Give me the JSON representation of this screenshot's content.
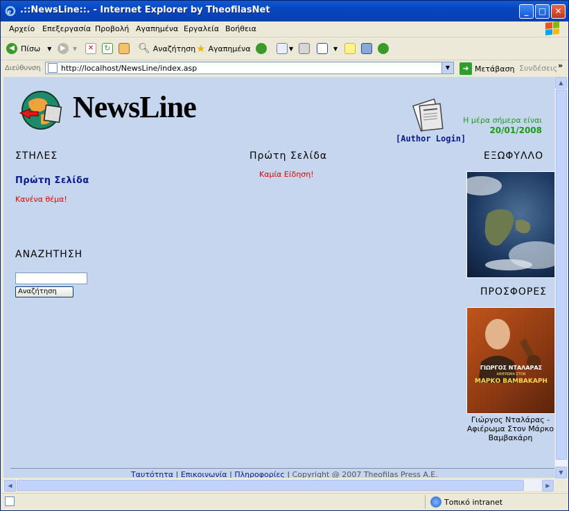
{
  "window": {
    "title": ".::NewsLine::. - Internet Explorer by TheofilasNet"
  },
  "menu": [
    "Αρχείο",
    "Επεξεργασία",
    "Προβολή",
    "Αγαπημένα",
    "Εργαλεία",
    "Βοήθεια"
  ],
  "toolbar": {
    "back": "Πίσω",
    "search": "Αναζήτηση",
    "favorites": "Αγαπημένα"
  },
  "address": {
    "label": "Διεύθυνση",
    "url": "http://localhost/NewsLine/index.asp",
    "go": "Μετάβαση",
    "links": "Συνδέσεις"
  },
  "page": {
    "brand": "NewsLine",
    "author_login": "[Author Login]",
    "date_label": "Η μέρα σήμερα είναι",
    "date_value": "20/01/2008",
    "columns_heading": "ΣΤΗΛΕΣ",
    "column_link": "Πρώτη Σελίδα",
    "no_topic": "Κανένα θέμα!",
    "search_heading": "ΑΝΑΖΗΤΗΣΗ",
    "search_value": "",
    "search_button": "Αναζήτηση",
    "center_heading": "Πρώτη Σελίδα",
    "no_news": "Καμία Είδηση!",
    "cover_heading": "ΕΞΩΦΥΛΛΟ",
    "offers_heading": "ΠΡΟΣΦΟΡΕΣ",
    "offer_image_line1": "ΓΙΩΡΓΟΣ ΝΤΑΛΑΡΑΣ",
    "offer_image_line2": "ΑΦΙΕΡΩΜΑ ΣΤΟΝ",
    "offer_image_line3": "ΜΑΡΚΟ ΒΑΜΒΑΚΑΡΗ",
    "offer_caption_1": "Γιώργος Νταλάρας -",
    "offer_caption_2": "Αφιέρωμα Στον Μάρκο",
    "offer_caption_3": "Βαμβακάρη"
  },
  "footer": {
    "link1": "Ταυτότητα",
    "link2": "Επικοινωνία",
    "link3": "Πληροφορίες",
    "sep": "|",
    "copyright": "Copyright @ 2007 Theofilas Press A.E."
  },
  "status": {
    "zone": "Τοπικό intranet"
  }
}
